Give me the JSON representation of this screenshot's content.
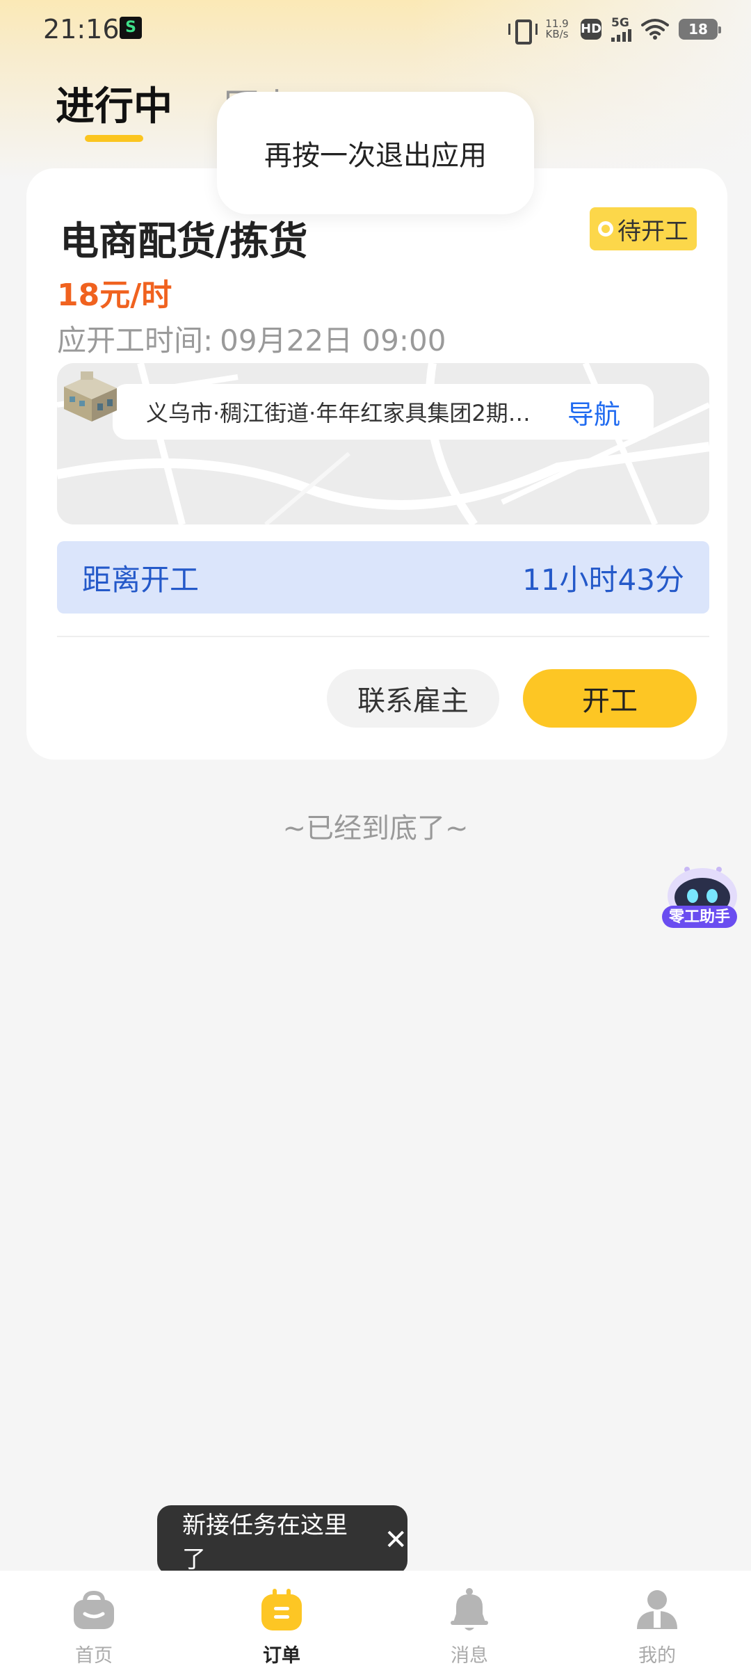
{
  "status_bar": {
    "time": "21:16",
    "net_speed_value": "11.9",
    "net_speed_unit": "KB/s",
    "hd_label": "HD",
    "network": "5G",
    "battery": "18"
  },
  "tabs": {
    "active": "进行中",
    "history": "历史"
  },
  "toast": "再按一次退出应用",
  "order": {
    "title": "电商配货/拣货",
    "status": "待开工",
    "wage": "18元/时",
    "start_label": "应开工时间:",
    "start_time": "09月22日 09:00",
    "address": "义乌市·稠江街道·年年红家具集团2期…",
    "nav_label": "导航",
    "countdown_label": "距离开工",
    "countdown_value": "11小时43分",
    "contact_button": "联系雇主",
    "start_button": "开工"
  },
  "list_end_text": "~已经到底了~",
  "assistant_label": "零工助手",
  "tooltip": "新接任务在这里了",
  "bottom_nav": [
    {
      "label": "首页",
      "icon": "bag-icon"
    },
    {
      "label": "订单",
      "icon": "order-icon",
      "active": true
    },
    {
      "label": "消息",
      "icon": "bell-icon"
    },
    {
      "label": "我的",
      "icon": "person-icon"
    }
  ],
  "colors": {
    "accent_yellow": "#fdc624",
    "wage_orange": "#f0621f",
    "link_blue": "#1f6af0"
  }
}
